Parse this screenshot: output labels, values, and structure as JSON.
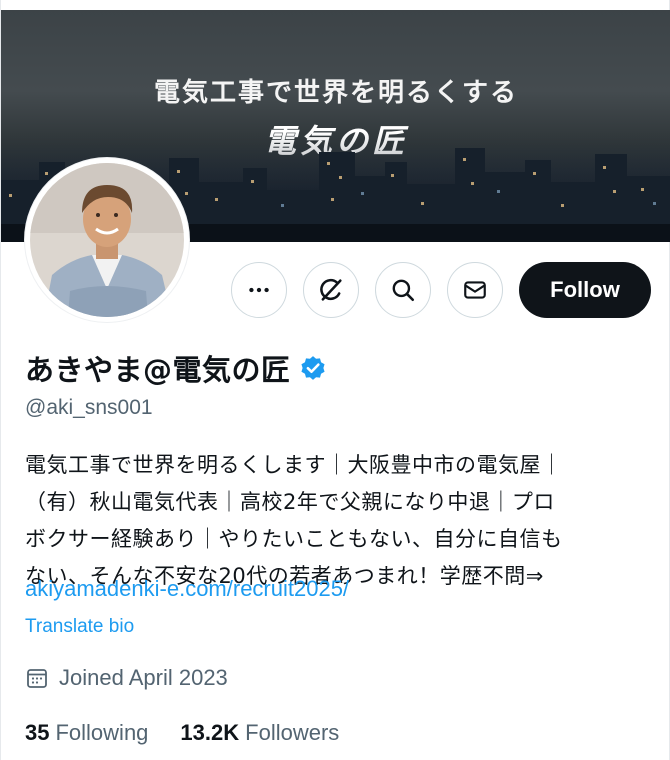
{
  "banner": {
    "title": "電気工事で世界を明るくする",
    "brand": "電気の匠"
  },
  "actions": {
    "more_icon": "more-horizontal-icon",
    "grok_icon": "grok-icon",
    "search_icon": "search-icon",
    "message_icon": "mail-icon",
    "follow_label": "Follow"
  },
  "profile": {
    "display_name": "あきやま@電気の匠",
    "handle": "@aki_sns001",
    "verified_color": "#1d9bf0",
    "bio_lines": [
      "電気工事で世界を明るくします｜大阪豊中市の電気屋｜",
      "（有）秋山電気代表｜高校2年で父親になり中退｜プロ",
      "ボクサー経験あり｜やりたいこともない、自分に自信も",
      "ない、そんな不安な20代の若者あつまれ！学歴不問⇒"
    ],
    "link": "akiyamadenki-e.com/recruit2025/",
    "translate_label": "Translate bio",
    "joined": "Joined April 2023"
  },
  "stats": {
    "following_count": "35",
    "following_label": "Following",
    "followers_count": "13.2K",
    "followers_label": "Followers"
  },
  "colors": {
    "accent": "#1d9bf0",
    "text": "#0f1419",
    "muted": "#536471",
    "follow_bg": "#0f1419"
  }
}
